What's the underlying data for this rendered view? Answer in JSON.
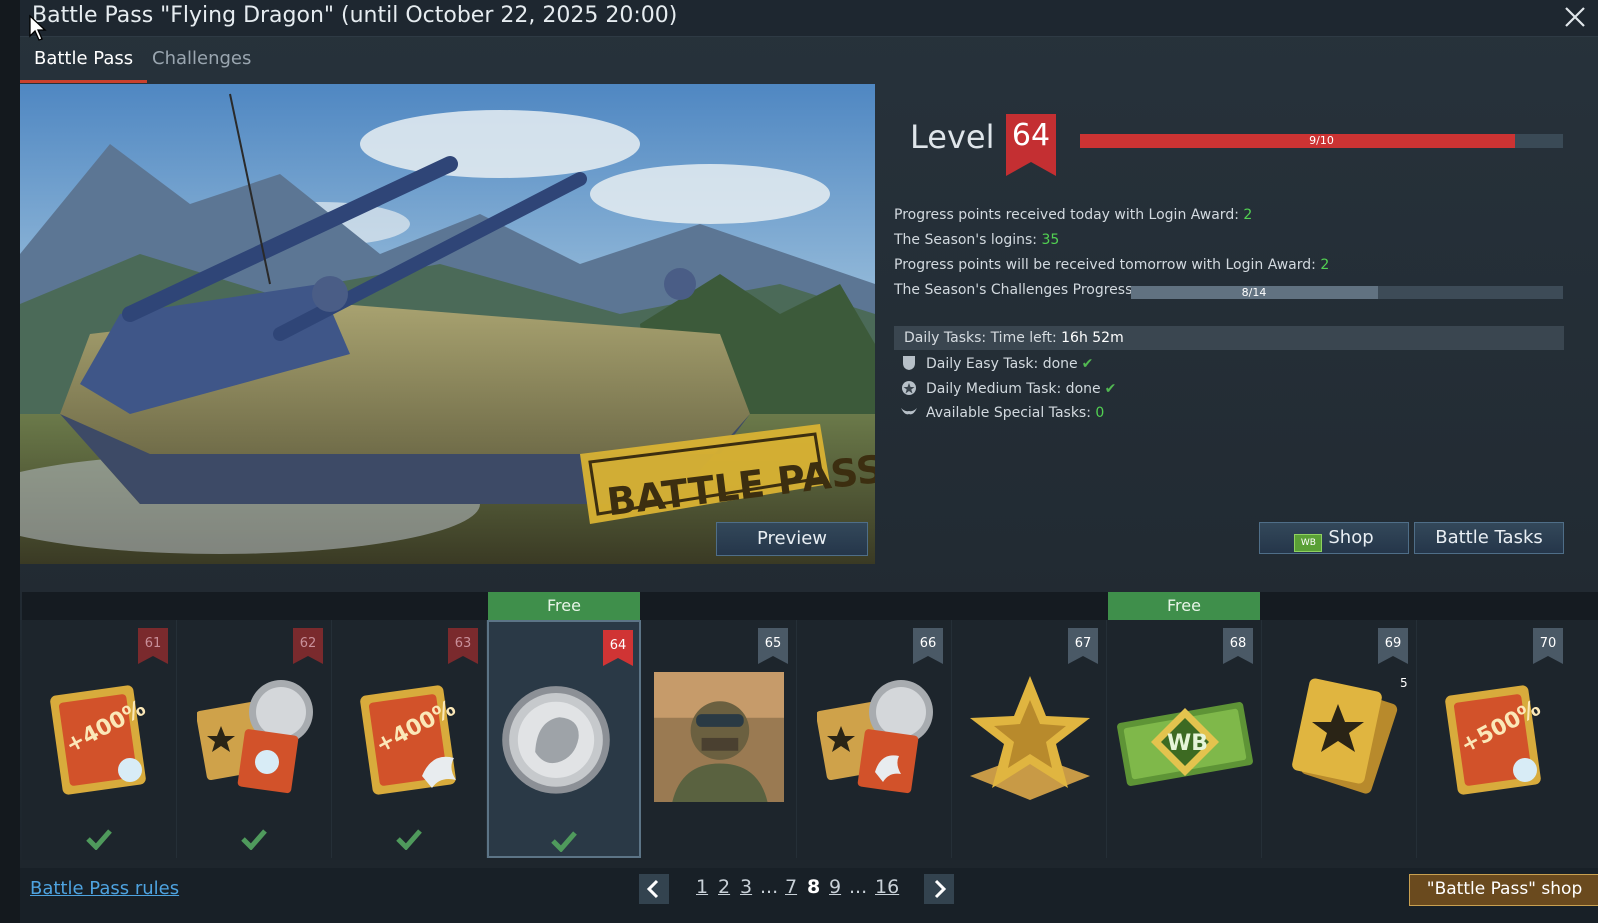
{
  "window": {
    "title": "Battle Pass \"Flying Dragon\" (until October 22, 2025 20:00)"
  },
  "tabs": [
    {
      "label": "Battle Pass",
      "active": true
    },
    {
      "label": "Challenges",
      "active": false
    }
  ],
  "hero": {
    "banner_text": "BATTLE PASS",
    "preview_label": "Preview"
  },
  "level": {
    "label": "Level",
    "value": "64",
    "progress_text": "9/10",
    "progress_fraction": 0.9
  },
  "stats": {
    "today_label": "Progress points received today with Login Award:",
    "today_value": "2",
    "logins_label": "The Season's logins:",
    "logins_value": "35",
    "tomorrow_label": "Progress points will be received tomorrow with Login Award:",
    "tomorrow_value": "2",
    "challenges_label": "The Season's Challenges Progress:",
    "challenges_text": "8/14",
    "challenges_fraction": 0.571
  },
  "daily": {
    "header_label": "Daily Tasks:",
    "time_label": "Time left:",
    "time_value": "16h 52m",
    "easy": "Daily Easy Task: done",
    "medium": "Daily Medium Task: done",
    "special_label": "Available Special Tasks:",
    "special_value": "0"
  },
  "buttons": {
    "shop": "Shop",
    "shop_icon_text": "WB",
    "battle_tasks": "Battle Tasks"
  },
  "free_label": "Free",
  "rewards": [
    {
      "level": "61",
      "item": "booster-400",
      "text": "+400%",
      "done": true
    },
    {
      "level": "62",
      "item": "card-pack",
      "text": "",
      "done": true
    },
    {
      "level": "63",
      "item": "booster-400-lion",
      "text": "+400%",
      "done": true
    },
    {
      "level": "64",
      "item": "silver-lion-coin",
      "text": "",
      "done": true
    },
    {
      "level": "65",
      "item": "soldier-portrait",
      "text": "",
      "done": false
    },
    {
      "level": "66",
      "item": "card-pack-lion",
      "text": "",
      "done": false
    },
    {
      "level": "67",
      "item": "gold-star",
      "text": "",
      "done": false
    },
    {
      "level": "68",
      "item": "warbonds",
      "text": "WB",
      "done": false
    },
    {
      "level": "69",
      "item": "star-cards",
      "text": "",
      "count": "5",
      "done": false
    },
    {
      "level": "70",
      "item": "booster-500",
      "text": "+500%",
      "done": false
    }
  ],
  "footer": {
    "rules_link": "Battle Pass rules",
    "pages": [
      "1",
      "2",
      "3",
      "...",
      "7",
      "8",
      "9",
      "...",
      "16"
    ],
    "current_page": "8",
    "shop_button": "\"Battle Pass\" shop"
  },
  "colors": {
    "accent_red": "#cc3333",
    "green_value": "#52d152",
    "free_green": "#3f8f4b",
    "link_blue": "#4ea3e0"
  }
}
